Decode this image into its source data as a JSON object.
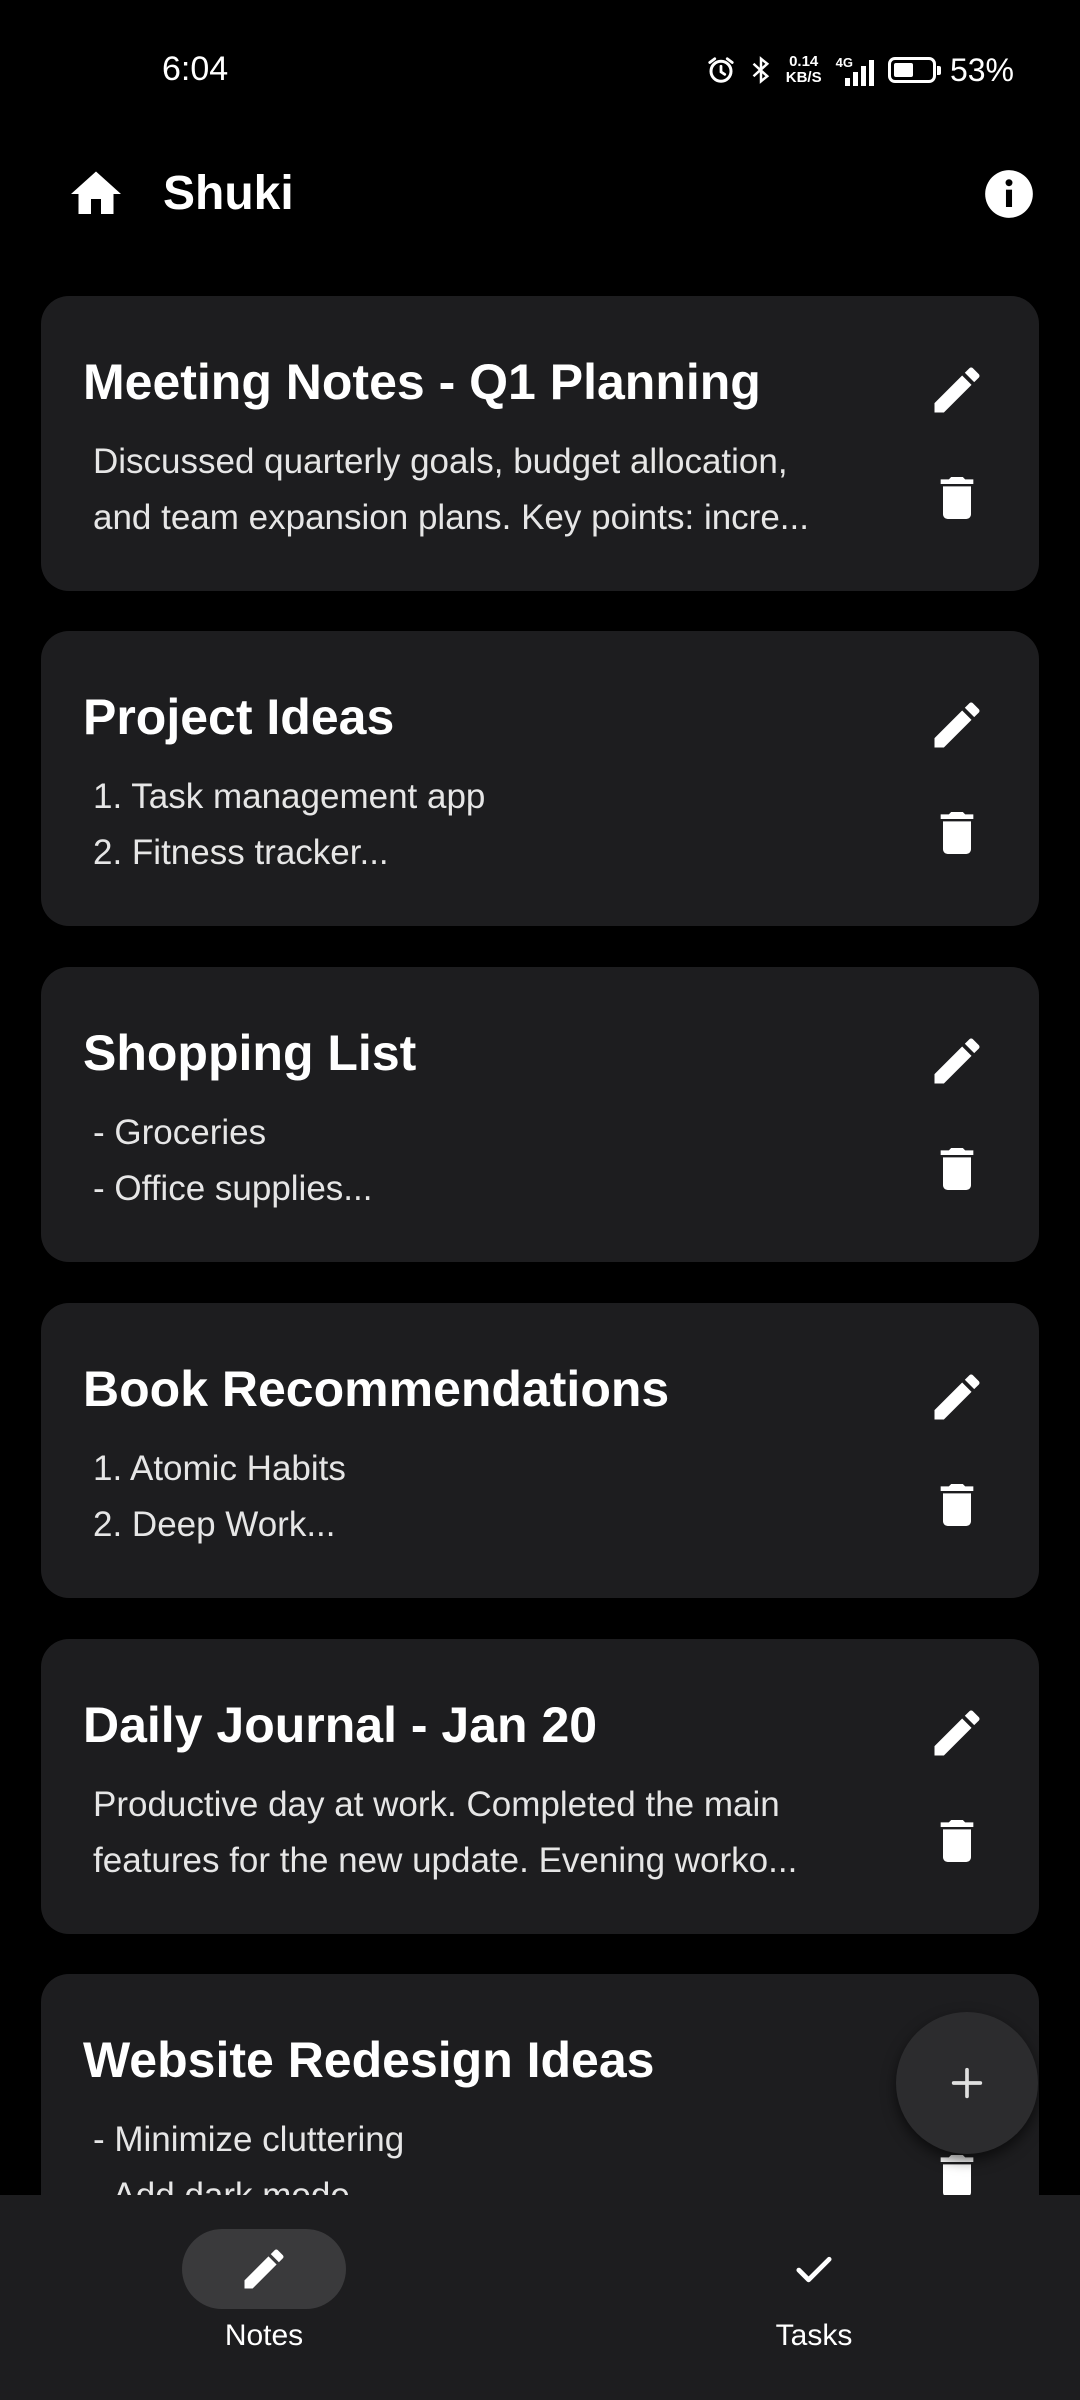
{
  "status_bar": {
    "time": "6:04",
    "net_speed_value": "0.14",
    "net_speed_unit": "KB/S",
    "network_type": "4G",
    "battery_percent": "53%",
    "battery_level": 0.53
  },
  "app_bar": {
    "title": "Shuki",
    "home_icon": "home-icon",
    "info_icon": "info-icon"
  },
  "notes": [
    {
      "title": "Meeting Notes - Q1 Planning",
      "lines": [
        "Discussed quarterly goals, budget allocation,",
        "and team expansion plans. Key points: incre..."
      ]
    },
    {
      "title": "Project Ideas",
      "lines": [
        "1. Task management app",
        "2. Fitness tracker..."
      ]
    },
    {
      "title": "Shopping List",
      "lines": [
        "- Groceries",
        "- Office supplies..."
      ]
    },
    {
      "title": "Book Recommendations",
      "lines": [
        "1. Atomic Habits",
        "2. Deep Work..."
      ]
    },
    {
      "title": "Daily Journal - Jan 20",
      "lines": [
        "Productive day at work. Completed the main",
        "features for the new update. Evening worko..."
      ]
    },
    {
      "title": "Website Redesign Ideas",
      "lines": [
        "- Minimize cluttering",
        "- Add dark mode"
      ]
    }
  ],
  "fab": {
    "icon": "plus-icon"
  },
  "bottom_nav": {
    "items": [
      {
        "label": "Notes",
        "icon": "pencil-icon",
        "selected": true
      },
      {
        "label": "Tasks",
        "icon": "check-icon",
        "selected": false
      }
    ]
  },
  "colors": {
    "background": "#000000",
    "card": "#1d1d1f",
    "nav_background": "#1d1d1f",
    "nav_selected_pill": "#3a3a3c",
    "fab": "#2c2c2e"
  }
}
